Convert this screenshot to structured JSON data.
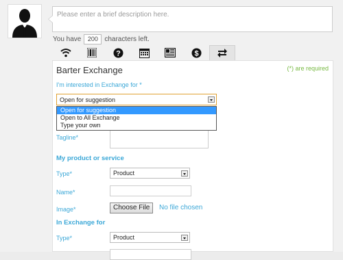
{
  "description": {
    "placeholder": "Please enter a brief description here."
  },
  "chars": {
    "prefix": "You have",
    "count": "200",
    "suffix": "characters left."
  },
  "icons": [
    "wifi-icon",
    "barcode-icon",
    "question-icon",
    "calendar-icon",
    "newspaper-icon",
    "dollar-icon",
    "exchange-icon"
  ],
  "form": {
    "title": "Barter Exchange",
    "required_note": "(*) are required",
    "interest_label": "I'm interested in Exchange for",
    "interest_selected": "Open for suggestion",
    "interest_options": [
      "Open for suggestion",
      "Open to All Exchange",
      "Type your own"
    ],
    "tagline_label": "Tagline",
    "product_section": "My product or service",
    "type_label": "Type",
    "type_value": "Product",
    "name_label": "Name",
    "image_label": "Image",
    "file_button": "Choose File",
    "file_status": "No file chosen",
    "exchange_section": "In Exchange for",
    "type2_label": "Type",
    "type2_value": "Product",
    "star": "*"
  }
}
